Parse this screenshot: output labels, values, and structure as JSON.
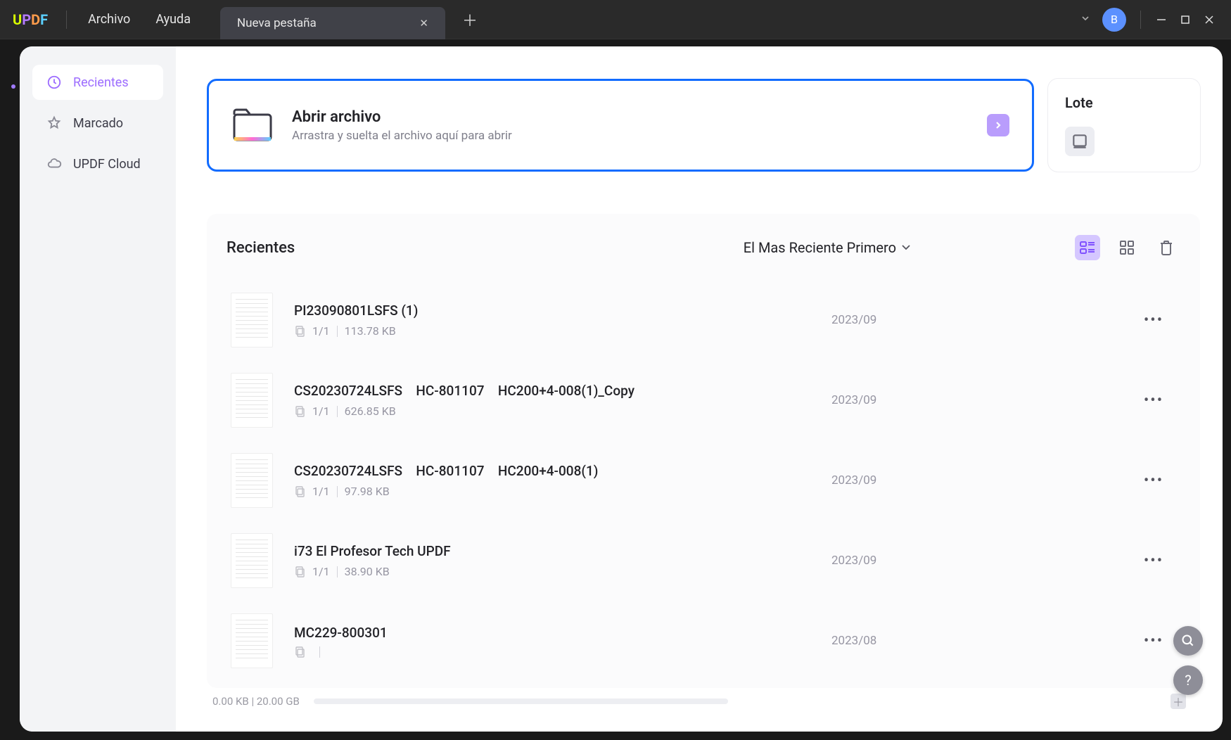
{
  "titlebar": {
    "logo": {
      "u": "U",
      "p": "P",
      "d": "D",
      "f": "F"
    },
    "menu_file": "Archivo",
    "menu_help": "Ayuda",
    "tab_name": "Nueva pestaña",
    "avatar_initial": "B"
  },
  "sidebar": {
    "recent": "Recientes",
    "starred": "Marcado",
    "cloud": "UPDF Cloud"
  },
  "open_card": {
    "title": "Abrir archivo",
    "subtitle": "Arrastra y suelta el archivo aquí para abrir"
  },
  "batch_card": {
    "title": "Lote"
  },
  "recents": {
    "title": "Recientes",
    "sort_label": "El Mas Reciente Primero",
    "files": [
      {
        "name": "PI23090801LSFS (1)",
        "pages": "1/1",
        "size": "113.78 KB",
        "date": "2023/09"
      },
      {
        "name": "CS20230724LSFS HC-801107 HC200+4-008(1)_Copy",
        "pages": "1/1",
        "size": "626.85 KB",
        "date": "2023/09"
      },
      {
        "name": "CS20230724LSFS HC-801107 HC200+4-008(1)",
        "pages": "1/1",
        "size": "97.98 KB",
        "date": "2023/09"
      },
      {
        "name": "i73 El Profesor Tech UPDF",
        "pages": "1/1",
        "size": "38.90 KB",
        "date": "2023/09"
      },
      {
        "name": "MC229-800301",
        "pages": "",
        "size": "",
        "date": "2023/08"
      }
    ]
  },
  "storage": {
    "text": "0.00 KB | 20.00 GB"
  }
}
